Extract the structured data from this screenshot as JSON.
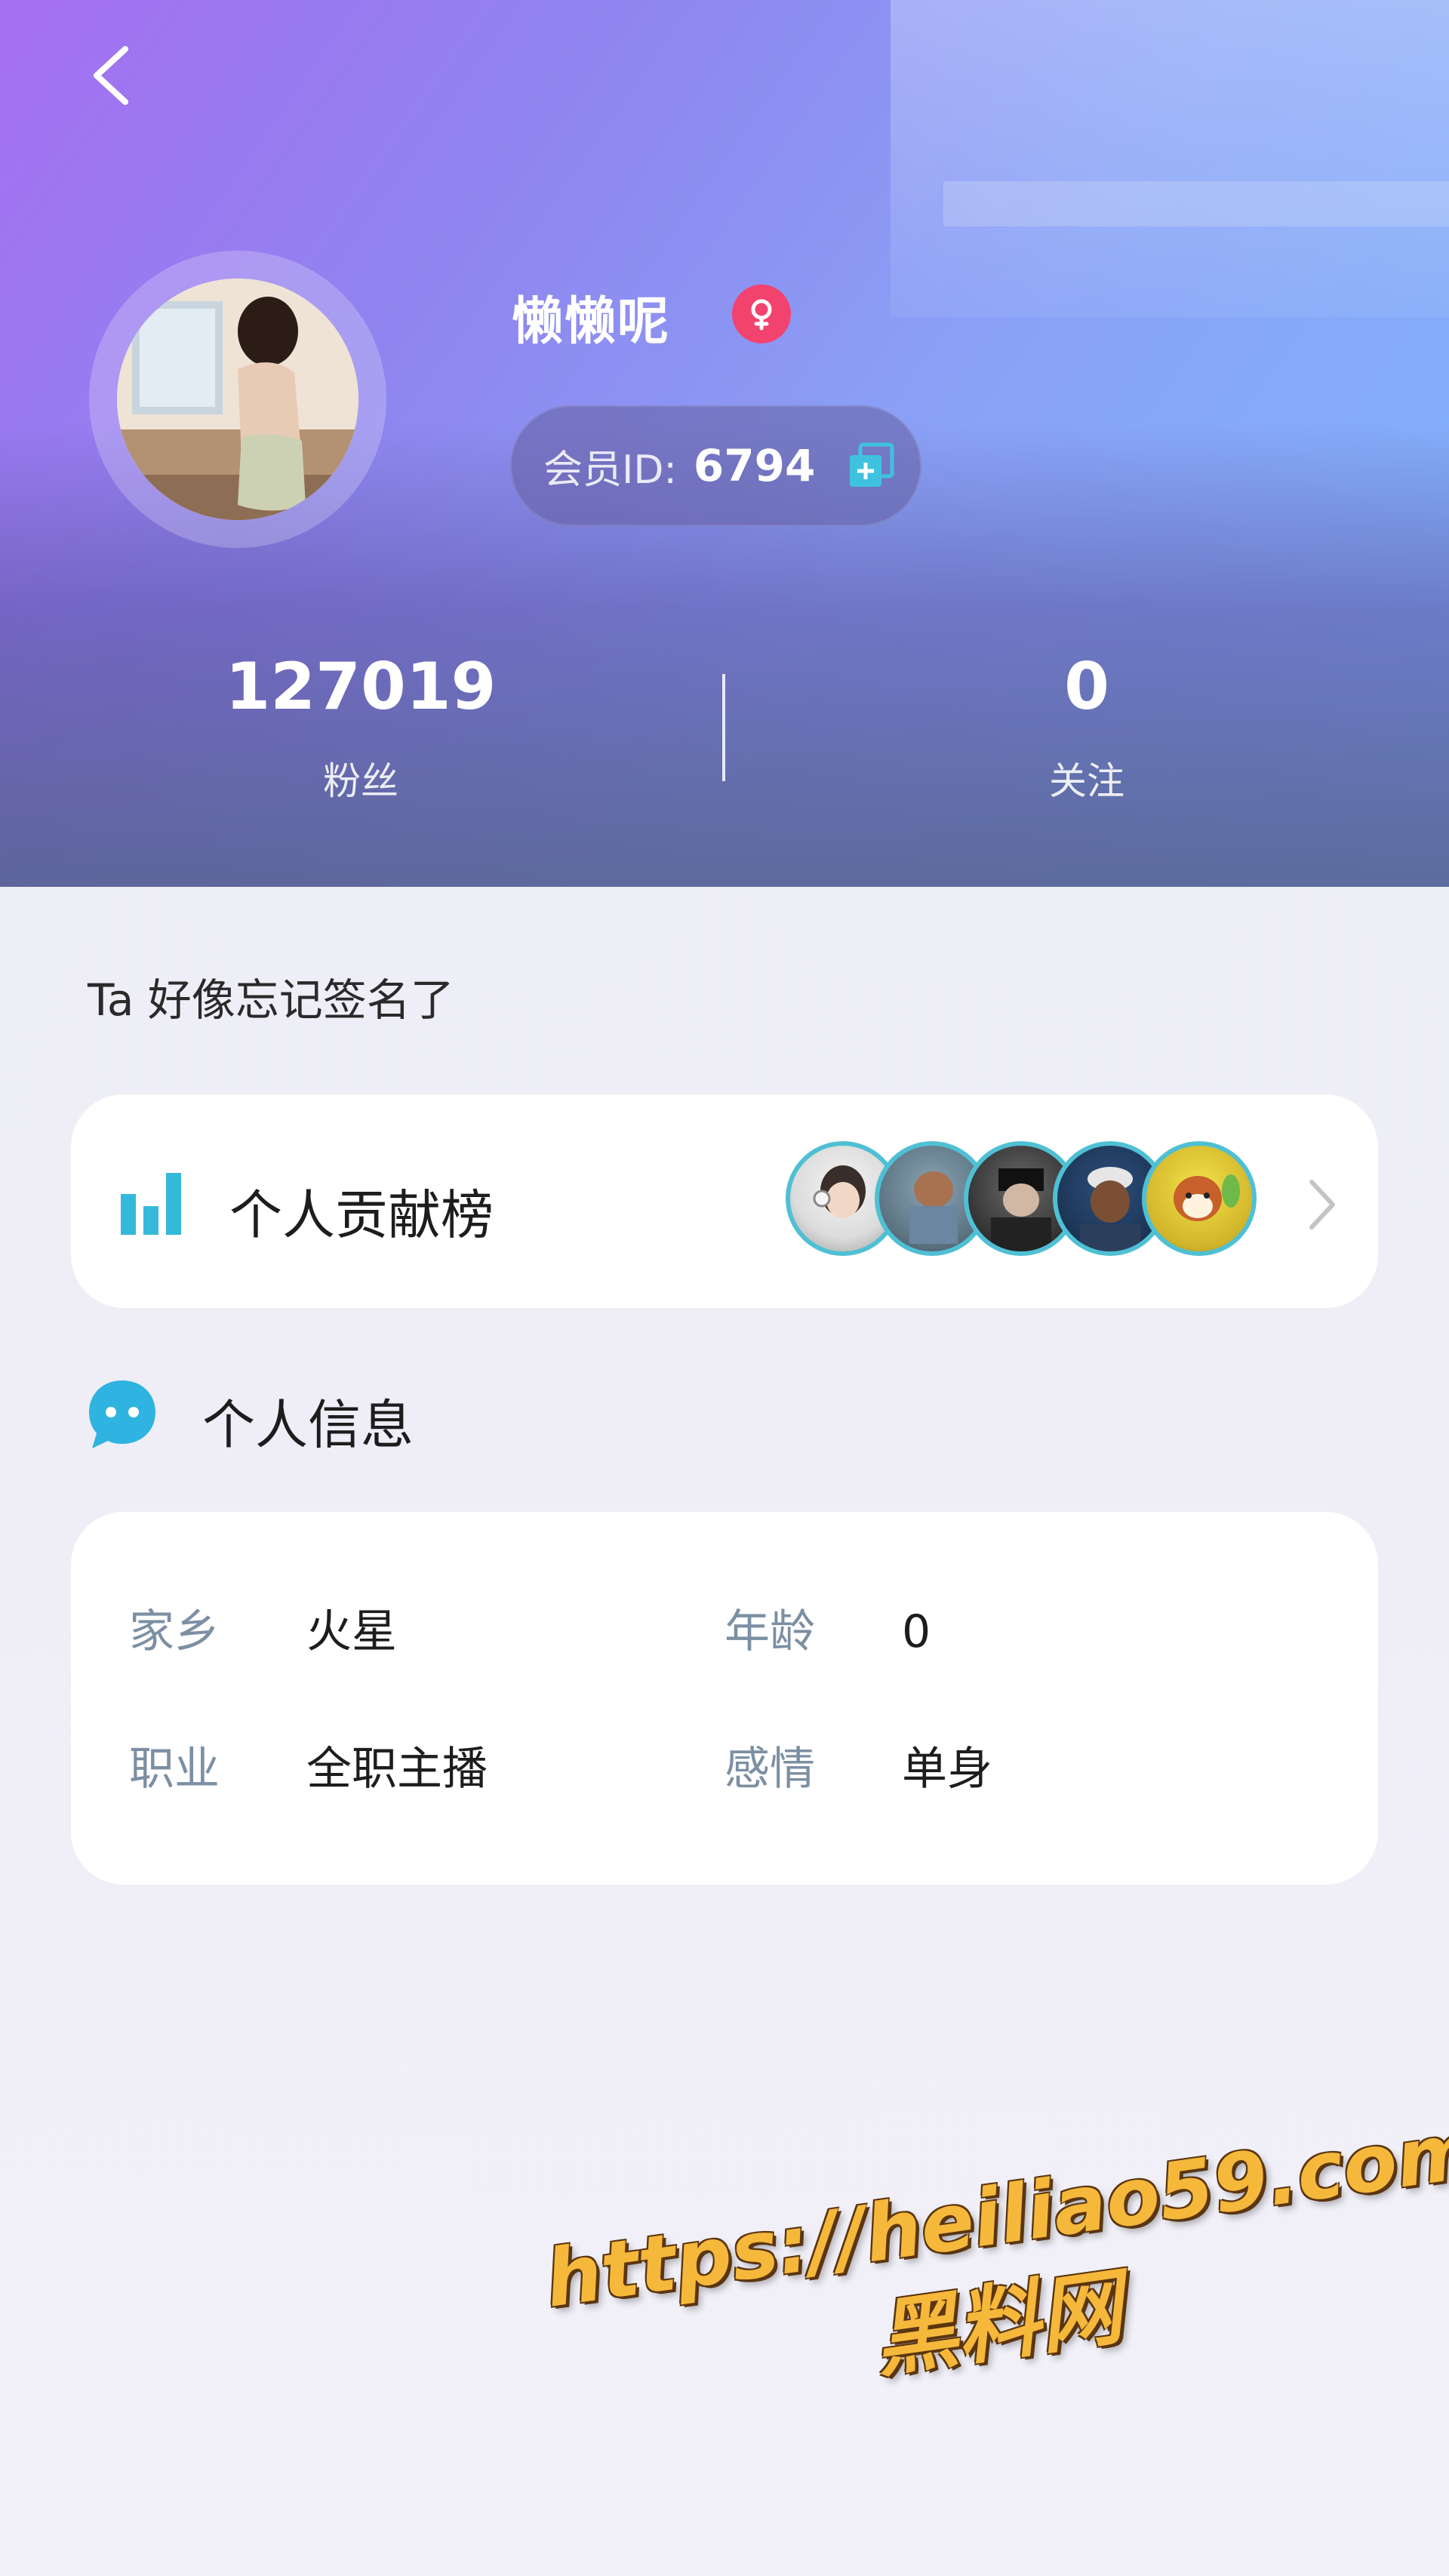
{
  "profile": {
    "username": "懒懒呢",
    "gender": "female",
    "member_label": "会员ID:",
    "member_id": "6794"
  },
  "stats": [
    {
      "value": "127019",
      "label": "粉丝"
    },
    {
      "value": "0",
      "label": "关注"
    }
  ],
  "signature": "Ta 好像忘记签名了",
  "contribution": {
    "title": "个人贡献榜",
    "avatar_count": 5
  },
  "info": {
    "title": "个人信息",
    "items": [
      {
        "key": "家乡",
        "value": "火星"
      },
      {
        "key": "年龄",
        "value": "0"
      },
      {
        "key": "职业",
        "value": "全职主播"
      },
      {
        "key": "感情",
        "value": "单身"
      }
    ]
  },
  "watermark": {
    "line1": "https://heiliao59.com",
    "line2": "黑料网"
  },
  "colors": {
    "header_gradient_start": "#a56ff2",
    "header_gradient_end": "#7fb5fb",
    "gender_badge": "#f2436f",
    "accent_cyan": "#35b9db",
    "info_key": "#7c8fa3",
    "watermark": "#f6b83a"
  },
  "icons": {
    "back": "chevron-left-icon",
    "gender": "female-icon",
    "copy": "copy-icon",
    "rank": "bar-chart-icon",
    "info": "chat-bubble-icon",
    "more": "chevron-right-icon"
  }
}
